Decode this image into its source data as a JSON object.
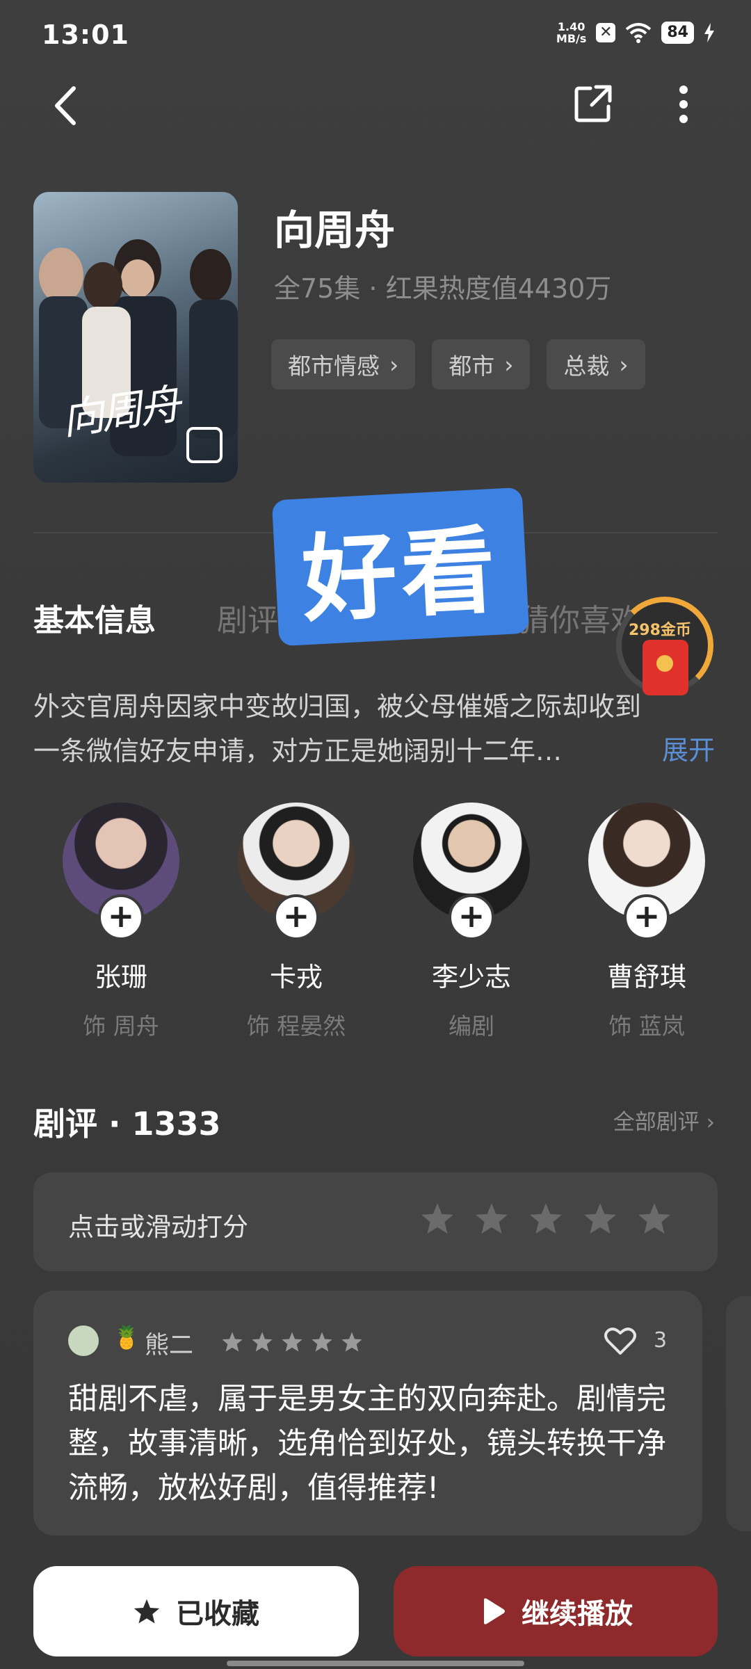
{
  "status_bar": {
    "time": "13:01",
    "net_speed_value": "1.40",
    "net_speed_unit": "MB/s",
    "battery": "84"
  },
  "drama": {
    "title": "向周舟",
    "meta": "全75集 · 红果热度值4430万",
    "poster_title": "向周舟",
    "tags": [
      "都市情感",
      "都市",
      "总裁"
    ]
  },
  "overlay_sticker": "好看",
  "tabs": [
    "基本信息",
    "剧评",
    "猜你喜欢"
  ],
  "coin_reward": {
    "label": "298金币"
  },
  "synopsis": {
    "line1": "外交官周舟因家中变故归国，被父母催婚之际却收到",
    "line2": "一条微信好友申请，对方正是她阔别十二年…",
    "expand": "展开"
  },
  "cast": [
    {
      "name": "张珊",
      "role": "饰 周舟"
    },
    {
      "name": "卡戎",
      "role": "饰 程晏然"
    },
    {
      "name": "李少志",
      "role": "编剧"
    },
    {
      "name": "曹舒琪",
      "role": "饰 蓝岚"
    }
  ],
  "reviews": {
    "heading": "剧评 · 1333",
    "all_reviews": "全部剧评 ›",
    "rate_prompt": "点击或滑动打分",
    "item": {
      "user": "熊二",
      "user_badge": "🍍",
      "stars": 5,
      "likes": "3",
      "text": "甜剧不虐，属于是男女主的双向奔赴。剧情完整，故事清晰，选角恰到好处，镜头转换干净流畅，放松好剧，值得推荐!"
    }
  },
  "actions": {
    "collect": "已收藏",
    "play": "继续播放"
  }
}
